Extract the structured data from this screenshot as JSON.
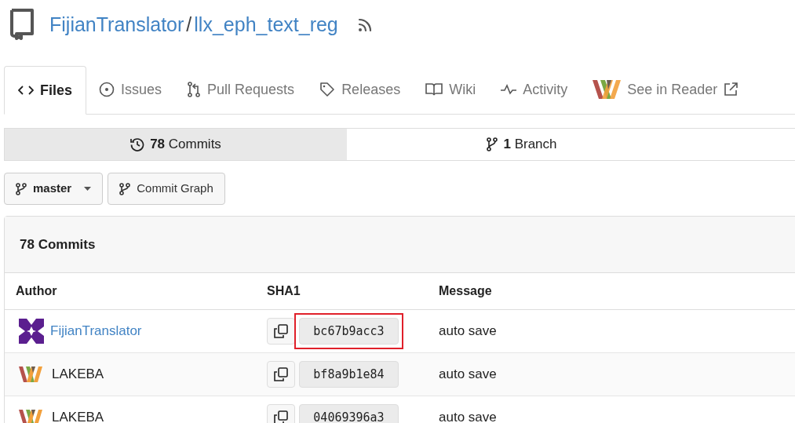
{
  "repo": {
    "owner": "FijianTranslator",
    "separator": "/",
    "name": "llx_eph_text_reg"
  },
  "tabs": [
    {
      "label": "Files",
      "selected": true
    },
    {
      "label": "Issues",
      "selected": false
    },
    {
      "label": "Pull Requests",
      "selected": false
    },
    {
      "label": "Releases",
      "selected": false
    },
    {
      "label": "Wiki",
      "selected": false
    },
    {
      "label": "Activity",
      "selected": false
    },
    {
      "label": "See in Reader",
      "selected": false
    }
  ],
  "summary_tabs": [
    {
      "count": "78",
      "label": "Commits",
      "selected": true
    },
    {
      "count": "1",
      "label": "Branch",
      "selected": false
    }
  ],
  "branch_button": {
    "label": "master"
  },
  "graph_button": {
    "label": "Commit Graph"
  },
  "commits": {
    "title": "78 Commits",
    "columns": [
      "Author",
      "SHA1",
      "Message"
    ],
    "rows": [
      {
        "author": "FijianTranslator",
        "kind": "user",
        "sha": "bc67b9acc3",
        "message": "auto save",
        "highlighted": true
      },
      {
        "author": "LAKEBA",
        "kind": "org",
        "sha": "bf8a9b1e84",
        "message": "auto save",
        "highlighted": false
      },
      {
        "author": "LAKEBA",
        "kind": "org",
        "sha": "04069396a3",
        "message": "auto save",
        "highlighted": false
      }
    ]
  }
}
